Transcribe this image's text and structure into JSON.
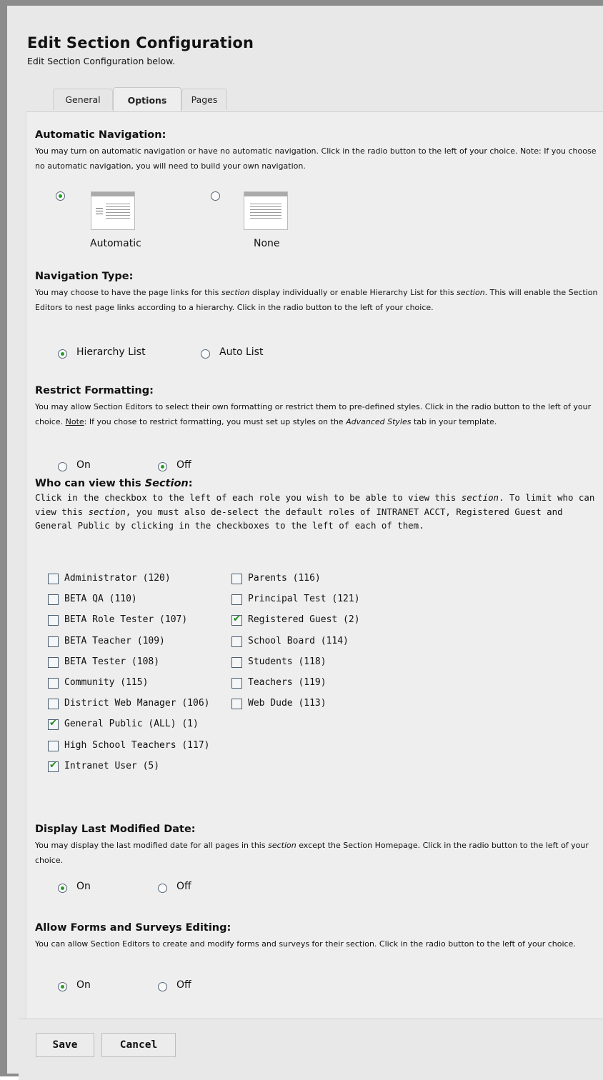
{
  "header": {
    "title": "Edit Section Configuration",
    "subtitle": "Edit Section Configuration below."
  },
  "tabs": [
    {
      "label": "General",
      "active": false
    },
    {
      "label": "Options",
      "active": true
    },
    {
      "label": "Pages",
      "active": false
    }
  ],
  "auto_nav": {
    "title": "Automatic Navigation:",
    "desc": "You may turn on automatic navigation or have no automatic navigation. Click in the radio button to the left of your choice. Note: If you choose no automatic navigation, you will need to build your own navigation.",
    "options": [
      {
        "label": "Automatic",
        "selected": true
      },
      {
        "label": "None",
        "selected": false
      }
    ]
  },
  "nav_type": {
    "title": "Navigation Type:",
    "desc_1": "You may choose to have the page links for this ",
    "desc_em_1": "section",
    "desc_2": " display individually or enable Hierarchy List for this ",
    "desc_em_2": "section",
    "desc_3": ". This will enable the Section Editors to nest page links according to a hierarchy. Click in the radio button to the left of your choice.",
    "options": [
      {
        "label": "Hierarchy List",
        "selected": true
      },
      {
        "label": "Auto List",
        "selected": false
      }
    ]
  },
  "restrict": {
    "title": "Restrict Formatting:",
    "desc_1": "You may allow Section Editors to select their own formatting or restrict them to pre-defined styles. Click in the radio button to the left of your choice. ",
    "desc_note": "Note",
    "desc_2": ": If you chose to restrict formatting, you must set up styles on the ",
    "desc_em": "Advanced Styles",
    "desc_3": " tab in your template.",
    "options": [
      {
        "label": "On",
        "selected": false
      },
      {
        "label": "Off",
        "selected": true
      }
    ]
  },
  "who_can_view": {
    "title_1": "Who can view this ",
    "title_em": "Section",
    "title_2": ":",
    "desc_1": "Click in the checkbox to the left of each role you wish to be able to view this ",
    "desc_em_1": "section",
    "desc_2": ". To limit who can view this ",
    "desc_em_2": "section",
    "desc_3": ", you must also de-select the default roles of INTRANET ACCT, Registered Guest and General Public by clicking in the checkboxes to the left of each of them.",
    "roles_left": [
      {
        "label": "Administrator (120)",
        "checked": false
      },
      {
        "label": "BETA QA (110)",
        "checked": false
      },
      {
        "label": "BETA Role Tester (107)",
        "checked": false
      },
      {
        "label": "BETA Teacher (109)",
        "checked": false
      },
      {
        "label": "BETA Tester (108)",
        "checked": false
      },
      {
        "label": "Community (115)",
        "checked": false
      },
      {
        "label": "District Web Manager (106)",
        "checked": false
      },
      {
        "label": "General Public (ALL) (1)",
        "checked": true
      },
      {
        "label": "High School Teachers (117)",
        "checked": false
      },
      {
        "label": "Intranet User (5)",
        "checked": true
      }
    ],
    "roles_right": [
      {
        "label": "Parents (116)",
        "checked": false
      },
      {
        "label": "Principal Test (121)",
        "checked": false
      },
      {
        "label": "Registered Guest (2)",
        "checked": true
      },
      {
        "label": "School Board (114)",
        "checked": false
      },
      {
        "label": "Students (118)",
        "checked": false
      },
      {
        "label": "Teachers (119)",
        "checked": false
      },
      {
        "label": "Web Dude (113)",
        "checked": false
      }
    ]
  },
  "last_modified": {
    "title": "Display Last Modified Date:",
    "desc_1": "You may display the last modified date for all pages in this ",
    "desc_em": "section",
    "desc_2": " except the Section Homepage. Click in the radio button to the left of your choice.",
    "options": [
      {
        "label": "On",
        "selected": true
      },
      {
        "label": "Off",
        "selected": false
      }
    ]
  },
  "forms": {
    "title": "Allow Forms and Surveys Editing:",
    "desc": "You can allow Section Editors to create and modify forms and surveys for their section. Click in the radio button to the left of your choice.",
    "options": [
      {
        "label": "On",
        "selected": true
      },
      {
        "label": "Off",
        "selected": false
      }
    ]
  },
  "buttons": {
    "save": "Save",
    "cancel": "Cancel"
  },
  "colors": {
    "frame": "#8c8c8c",
    "panel": "#eeeeee",
    "radio_dot": "#2a9a2a",
    "check": "#1c8a1c"
  }
}
